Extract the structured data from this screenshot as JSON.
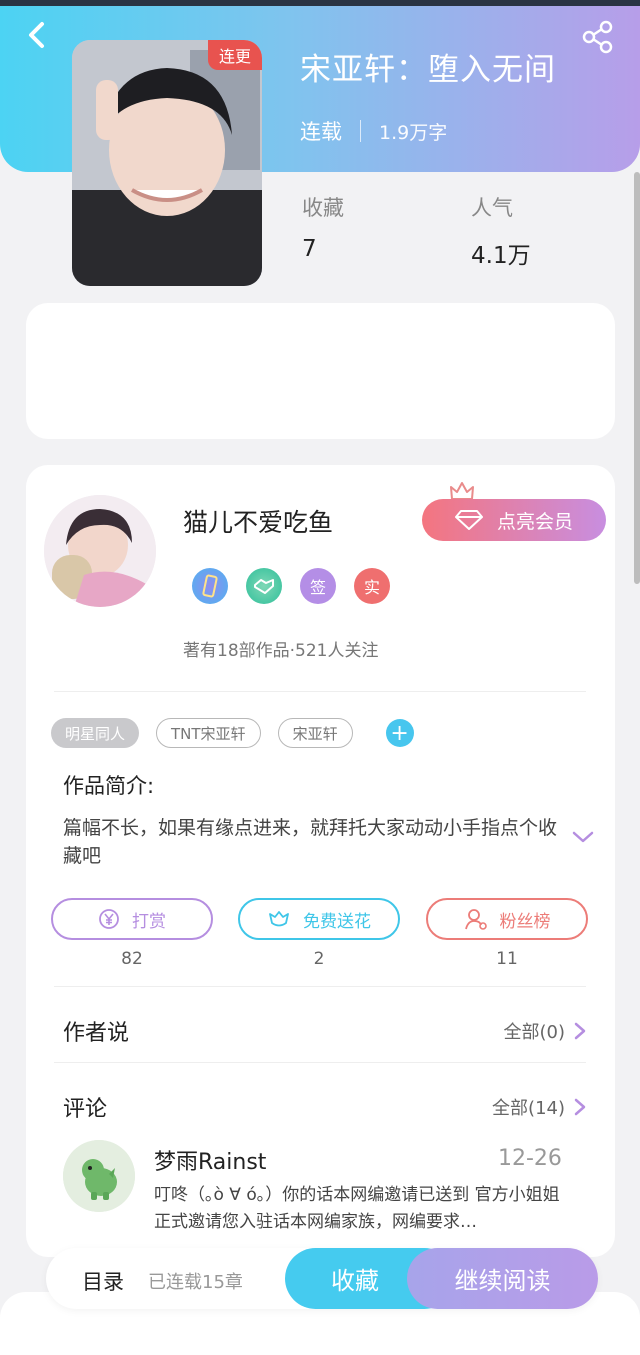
{
  "book": {
    "cover_badge": "连更",
    "title": "宋亚轩：堕入无间",
    "status": "连载",
    "word_count": "1.9万字"
  },
  "stats": [
    {
      "label": "收藏",
      "value": "7"
    },
    {
      "label": "人气",
      "value": "4.1万"
    }
  ],
  "author": {
    "name": "猫儿不爱吃鱼",
    "vip_label": "点亮会员",
    "badges": [
      "签",
      "实"
    ],
    "meta": "著有18部作品·521人关注"
  },
  "tags": [
    "明星同人",
    "TNT宋亚轩",
    "宋亚轩"
  ],
  "intro": {
    "title": "作品简介:",
    "text": "篇幅不长，如果有缘点进来，就拜托大家动动小手指点个收藏吧"
  },
  "actions": [
    {
      "label": "打赏",
      "count": "82",
      "color": "#b58ee0"
    },
    {
      "label": "免费送花",
      "count": "2",
      "color": "#3fc6e8"
    },
    {
      "label": "粉丝榜",
      "count": "11",
      "color": "#ec7c78"
    }
  ],
  "author_says": {
    "title": "作者说",
    "all": "全部(0)"
  },
  "comments": {
    "title": "评论",
    "all": "全部(14)",
    "items": [
      {
        "user": "梦雨Rainst",
        "date": "12-26",
        "text": "叮咚（｡ò ∀ ó｡）你的话本网编邀请已送到 官方小姐姐正式邀请您入驻话本网编家族，网编要求…"
      }
    ]
  },
  "bottom_bar": {
    "toc_label": "目录",
    "toc_count": "已连载15章",
    "collect_label": "收藏",
    "read_label": "继续阅读"
  },
  "colors": {
    "header_start": "#4cd3f3",
    "header_end": "#b79ee9",
    "accent_purple": "#b58ee0",
    "accent_blue": "#45cbef",
    "badge_red": "#e8534f"
  }
}
